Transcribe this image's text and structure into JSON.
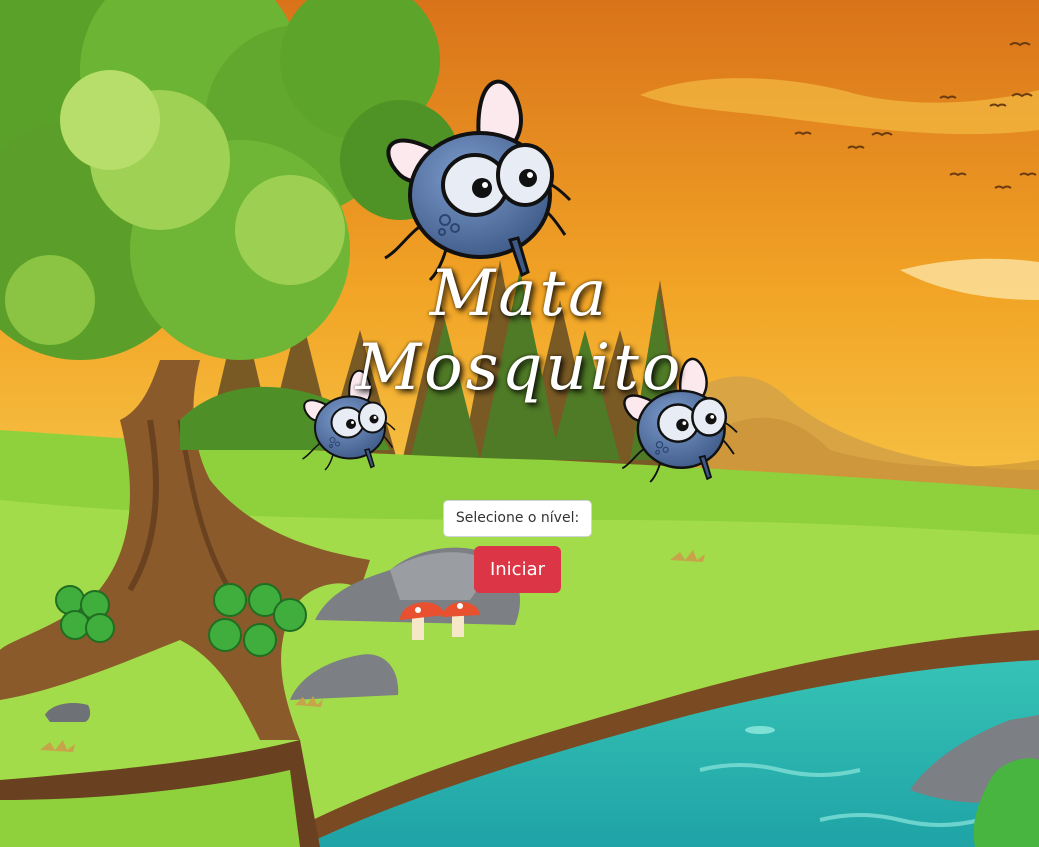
{
  "game": {
    "title_line1": "Mata",
    "title_line2": "Mosquito"
  },
  "controls": {
    "level_select_placeholder": "Selecione o nível:",
    "start_label": "Iniciar"
  },
  "colors": {
    "sky_top": "#e8901a",
    "sky_bottom": "#f7d45a",
    "grass": "#8fd13c",
    "river": "#2fb9b0",
    "start_button": "#dc3545",
    "fly_body": "#5a7cae"
  }
}
